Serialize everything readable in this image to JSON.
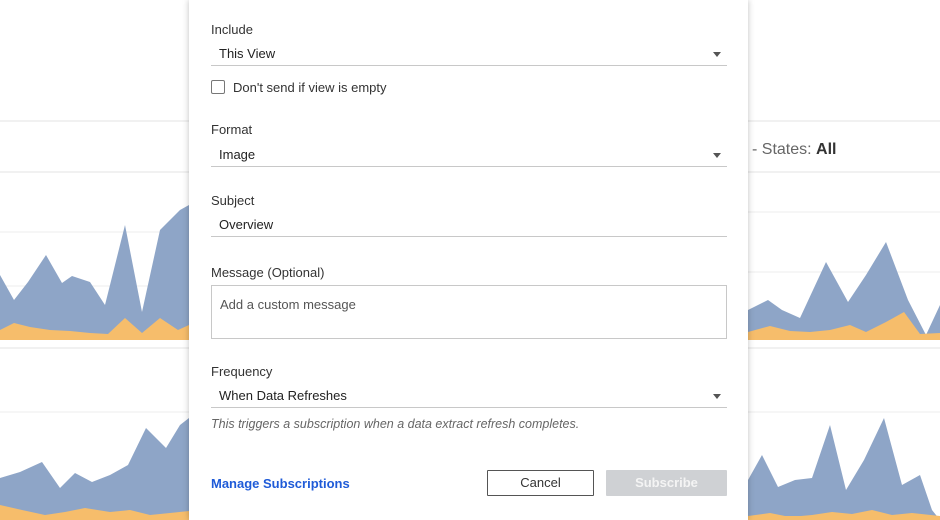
{
  "background": {
    "states_prefix": "- States: ",
    "states_value": "All",
    "colors": {
      "area_blue": "#8ea5c7",
      "area_orange": "#f6bd6b",
      "grid": "#e6e6e6"
    }
  },
  "dialog": {
    "include": {
      "label": "Include",
      "value": "This View"
    },
    "empty_check": {
      "label": "Don't send if view is empty",
      "checked": false
    },
    "format": {
      "label": "Format",
      "value": "Image"
    },
    "subject": {
      "label": "Subject",
      "value": "Overview"
    },
    "message": {
      "label": "Message (Optional)",
      "placeholder": "Add a custom message"
    },
    "frequency": {
      "label": "Frequency",
      "value": "When Data Refreshes",
      "hint": "This triggers a subscription when a data extract refresh completes."
    },
    "manage_link": "Manage Subscriptions",
    "cancel_label": "Cancel",
    "subscribe_label": "Subscribe",
    "colors": {
      "link": "#1f5bd8",
      "disabled_button": "#cfd1d4"
    }
  }
}
